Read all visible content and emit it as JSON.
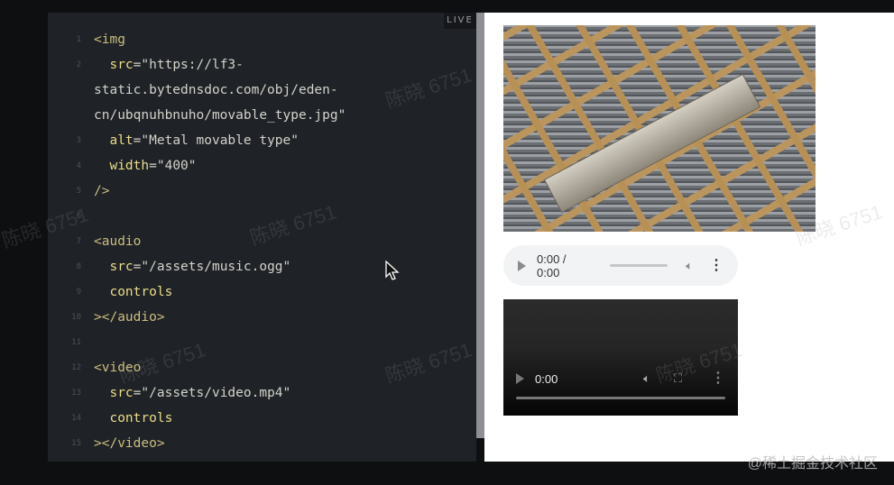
{
  "editor": {
    "live_label": "LIVE",
    "lines": [
      {
        "n": "1",
        "tokens": [
          [
            "tag",
            "<img"
          ]
        ]
      },
      {
        "n": "2",
        "tokens": [
          [
            "str",
            "  "
          ],
          [
            "attr",
            "src"
          ],
          [
            "str",
            "=\"https://lf3-"
          ]
        ]
      },
      {
        "n": "",
        "tokens": [
          [
            "str",
            "static.bytednsdoc.com/obj/eden-"
          ]
        ]
      },
      {
        "n": "",
        "tokens": [
          [
            "str",
            "cn/ubqnuhbnuho/movable_type.jpg\""
          ]
        ]
      },
      {
        "n": "3",
        "tokens": [
          [
            "str",
            "  "
          ],
          [
            "attr",
            "alt"
          ],
          [
            "str",
            "=\"Metal movable type\""
          ]
        ]
      },
      {
        "n": "4",
        "tokens": [
          [
            "str",
            "  "
          ],
          [
            "attr",
            "width"
          ],
          [
            "str",
            "=\"400\""
          ]
        ]
      },
      {
        "n": "5",
        "tokens": [
          [
            "tag",
            "/>"
          ]
        ]
      },
      {
        "n": "6",
        "tokens": []
      },
      {
        "n": "7",
        "tokens": [
          [
            "tag",
            "<audio"
          ]
        ]
      },
      {
        "n": "8",
        "tokens": [
          [
            "str",
            "  "
          ],
          [
            "attr",
            "src"
          ],
          [
            "str",
            "=\"/assets/music.ogg\""
          ]
        ]
      },
      {
        "n": "9",
        "tokens": [
          [
            "str",
            "  "
          ],
          [
            "attr",
            "controls"
          ]
        ]
      },
      {
        "n": "10",
        "tokens": [
          [
            "tag",
            "></audio>"
          ]
        ]
      },
      {
        "n": "11",
        "tokens": []
      },
      {
        "n": "12",
        "tokens": [
          [
            "tag",
            "<video"
          ]
        ]
      },
      {
        "n": "13",
        "tokens": [
          [
            "str",
            "  "
          ],
          [
            "attr",
            "src"
          ],
          [
            "str",
            "=\"/assets/video.mp4\""
          ]
        ]
      },
      {
        "n": "14",
        "tokens": [
          [
            "str",
            "  "
          ],
          [
            "attr",
            "controls"
          ]
        ]
      },
      {
        "n": "15",
        "tokens": [
          [
            "tag",
            "></video>"
          ]
        ]
      }
    ]
  },
  "preview": {
    "audio": {
      "time": "0:00 / 0:00",
      "progress": 0
    },
    "video": {
      "time": "0:00",
      "progress": 0
    }
  },
  "watermark": "陈晓 6751",
  "footer": "@稀土掘金技术社区"
}
